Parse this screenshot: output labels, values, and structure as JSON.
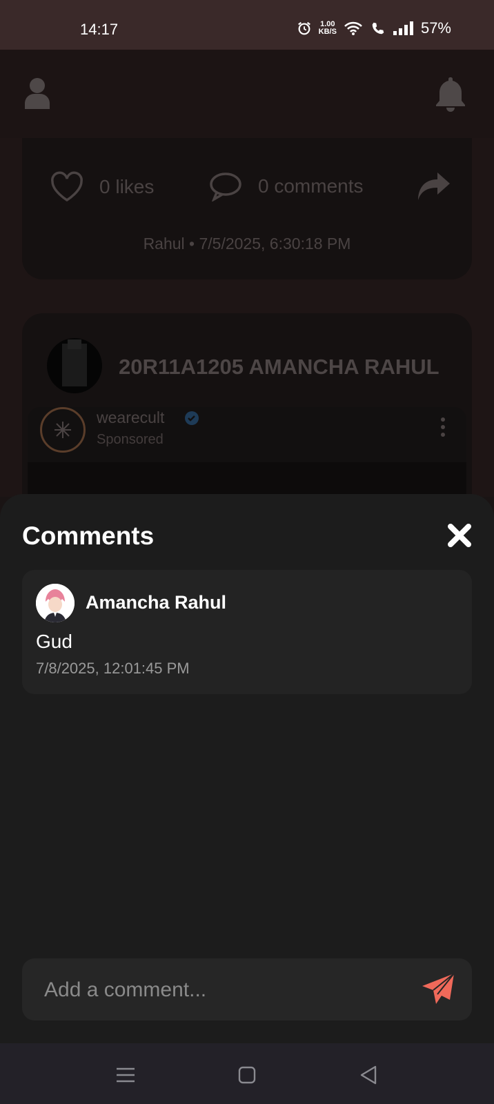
{
  "status": {
    "time": "14:17",
    "net_speed_value": "1.00",
    "net_speed_unit": "KB/S",
    "battery": "57%"
  },
  "post": {
    "likes": "0 likes",
    "comments": "0 comments",
    "meta": "Rahul • 7/5/2025, 6:30:18 PM"
  },
  "post2": {
    "author": "20R11A1205 AMANCHA RAHUL",
    "ad_name": "wearecult",
    "ad_label": "Sponsored"
  },
  "comments_sheet": {
    "title": "Comments",
    "items": [
      {
        "user": "Amancha Rahul",
        "text": "Gud",
        "time": "7/8/2025, 12:01:45 PM"
      }
    ],
    "input_placeholder": "Add a comment..."
  },
  "colors": {
    "send_accent": "#f0695a",
    "sheet_bg": "#1c1c1c",
    "status_bar": "#3a2929"
  }
}
